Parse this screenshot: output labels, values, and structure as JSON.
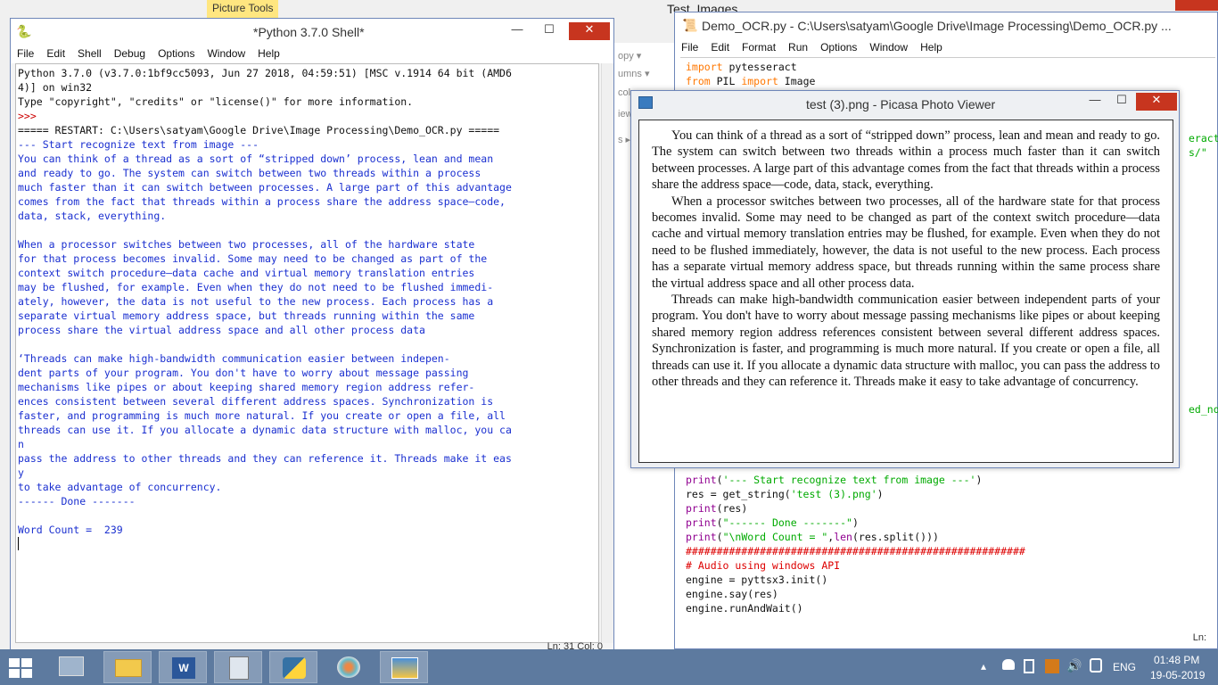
{
  "background": {
    "picture_tools_tab": "Picture Tools",
    "test_images_title": "Test_Images",
    "explorer_fragments": [
      "opy ▾",
      "umns ▾",
      "col",
      "iew",
      "s ▸"
    ]
  },
  "shell": {
    "title": "*Python 3.7.0 Shell*",
    "menu": [
      "File",
      "Edit",
      "Shell",
      "Debug",
      "Options",
      "Window",
      "Help"
    ],
    "lines": [
      {
        "text": "Python 3.7.0 (v3.7.0:1bf9cc5093, Jun 27 2018, 04:59:51) [MSC v.1914 64 bit (AMD6",
        "color": "black"
      },
      {
        "text": "4)] on win32",
        "color": "black"
      },
      {
        "text": "Type \"copyright\", \"credits\" or \"license()\" for more information.",
        "color": "black"
      },
      {
        "text": ">>> ",
        "color": "red"
      },
      {
        "text": "===== RESTART: C:\\Users\\satyam\\Google Drive\\Image Processing\\Demo_OCR.py =====",
        "color": "black"
      },
      {
        "text": "--- Start recognize text from image ---",
        "color": "blue"
      },
      {
        "text": "You can think of a thread as a sort of “stripped down’ process, lean and mean",
        "color": "blue"
      },
      {
        "text": "and ready to go. The system can switch between two threads within a process",
        "color": "blue"
      },
      {
        "text": "much faster than it can switch between processes. A large part of this advantage",
        "color": "blue"
      },
      {
        "text": "comes from the fact that threads within a process share the address space—code,",
        "color": "blue"
      },
      {
        "text": "data, stack, everything.",
        "color": "blue"
      },
      {
        "text": "",
        "color": "blue"
      },
      {
        "text": "When a processor switches between two processes, all of the hardware state",
        "color": "blue"
      },
      {
        "text": "for that process becomes invalid. Some may need to be changed as part of the",
        "color": "blue"
      },
      {
        "text": "context switch procedure—data cache and virtual memory translation entries",
        "color": "blue"
      },
      {
        "text": "may be flushed, for example. Even when they do not need to be flushed immedi-",
        "color": "blue"
      },
      {
        "text": "ately, however, the data is not useful to the new process. Each process has a",
        "color": "blue"
      },
      {
        "text": "separate virtual memory address space, but threads running within the same",
        "color": "blue"
      },
      {
        "text": "process share the virtual address space and all other process data",
        "color": "blue"
      },
      {
        "text": "",
        "color": "blue"
      },
      {
        "text": "‘Threads can make high-bandwidth communication easier between indepen-",
        "color": "blue"
      },
      {
        "text": "dent parts of your program. You don't have to worry about message passing",
        "color": "blue"
      },
      {
        "text": "mechanisms like pipes or about keeping shared memory region address refer-",
        "color": "blue"
      },
      {
        "text": "ences consistent between several different address spaces. Synchronization is",
        "color": "blue"
      },
      {
        "text": "faster, and programming is much more natural. If you create or open a file, all",
        "color": "blue"
      },
      {
        "text": "threads can use it. If you allocate a dynamic data structure with malloc, you ca",
        "color": "blue"
      },
      {
        "text": "n",
        "color": "blue"
      },
      {
        "text": "pass the address to other threads and they can reference it. Threads make it eas",
        "color": "blue"
      },
      {
        "text": "y",
        "color": "blue"
      },
      {
        "text": "to take advantage of concurrency.",
        "color": "blue"
      },
      {
        "text": "------ Done -------",
        "color": "blue"
      },
      {
        "text": "",
        "color": "blue"
      },
      {
        "text": "Word Count =  239",
        "color": "blue"
      }
    ],
    "status": "Ln: 31   Col: 0"
  },
  "editor": {
    "title": "Demo_OCR.py - C:\\Users\\satyam\\Google Drive\\Image Processing\\Demo_OCR.py ...",
    "menu": [
      "File",
      "Edit",
      "Format",
      "Run",
      "Options",
      "Window",
      "Help"
    ],
    "top_lines": [
      [
        {
          "t": "import",
          "c": "kw"
        },
        {
          "t": " pytesseract",
          "c": "plain"
        }
      ],
      [
        {
          "t": "from",
          "c": "kw"
        },
        {
          "t": " PIL ",
          "c": "plain"
        },
        {
          "t": "import",
          "c": "kw"
        },
        {
          "t": " Image",
          "c": "plain"
        }
      ]
    ],
    "right_fragments": [
      "eract-",
      "s/\"",
      "ed_noi"
    ],
    "bottom_lines": [
      [
        {
          "t": "print",
          "c": "fn"
        },
        {
          "t": "(",
          "c": "plain"
        },
        {
          "t": "'--- Start recognize text from image ---'",
          "c": "str"
        },
        {
          "t": ")",
          "c": "plain"
        }
      ],
      [
        {
          "t": "res = get_string(",
          "c": "plain"
        },
        {
          "t": "'test (3).png'",
          "c": "str"
        },
        {
          "t": ")",
          "c": "plain"
        }
      ],
      [
        {
          "t": "print",
          "c": "fn"
        },
        {
          "t": "(res)",
          "c": "plain"
        }
      ],
      [
        {
          "t": "print",
          "c": "fn"
        },
        {
          "t": "(",
          "c": "plain"
        },
        {
          "t": "\"------ Done -------\"",
          "c": "str"
        },
        {
          "t": ")",
          "c": "plain"
        }
      ],
      [
        {
          "t": "print",
          "c": "fn"
        },
        {
          "t": "(",
          "c": "plain"
        },
        {
          "t": "\"\\nWord Count = \"",
          "c": "str"
        },
        {
          "t": ",",
          "c": "plain"
        },
        {
          "t": "len",
          "c": "fn"
        },
        {
          "t": "(res.split()))",
          "c": "plain"
        }
      ],
      [
        {
          "t": "#######################################################",
          "c": "cm"
        }
      ],
      [
        {
          "t": "# Audio using windows API",
          "c": "cm"
        }
      ],
      [
        {
          "t": "engine = pyttsx3.init()",
          "c": "plain"
        }
      ],
      [
        {
          "t": "engine.say(res)",
          "c": "plain"
        }
      ],
      [
        {
          "t": "engine.runAndWait()",
          "c": "plain"
        }
      ]
    ],
    "status": "Ln:"
  },
  "picasa": {
    "title": "test (3).png - Picasa Photo Viewer",
    "paragraphs": [
      "You can think of a thread as a sort of “stripped down” process, lean and mean and ready to go. The system can switch between two threads within a process much faster than it can switch between processes. A large part of this advantage comes from the fact that threads within a process share the address space—code, data, stack, everything.",
      "When a processor switches between two processes, all of the hardware state for that process becomes invalid. Some may need to be changed as part of the context switch procedure—data cache and virtual memory translation entries may be flushed, for example. Even when they do not need to be flushed immediately, however, the data is not useful to the new process. Each process has a separate virtual memory address space, but threads running within the same process share the virtual address space and all other process data.",
      "Threads can make high-bandwidth communication easier between independent parts of your program. You don't have to worry about message passing mechanisms like pipes or about keeping shared memory region address references consistent between several different address spaces. Synchronization is faster, and programming is much more natural. If you create or open a file, all threads can use it. If you allocate a dynamic data structure with malloc, you can pass the address to other threads and they can reference it. Threads make it easy to take advantage of concurrency."
    ]
  },
  "window_controls": {
    "minimize": "—",
    "maximize": "☐",
    "close": "✕"
  },
  "taskbar": {
    "language": "ENG",
    "time": "01:48 PM",
    "date": "19-05-2019",
    "tray_arrow": "▴"
  }
}
